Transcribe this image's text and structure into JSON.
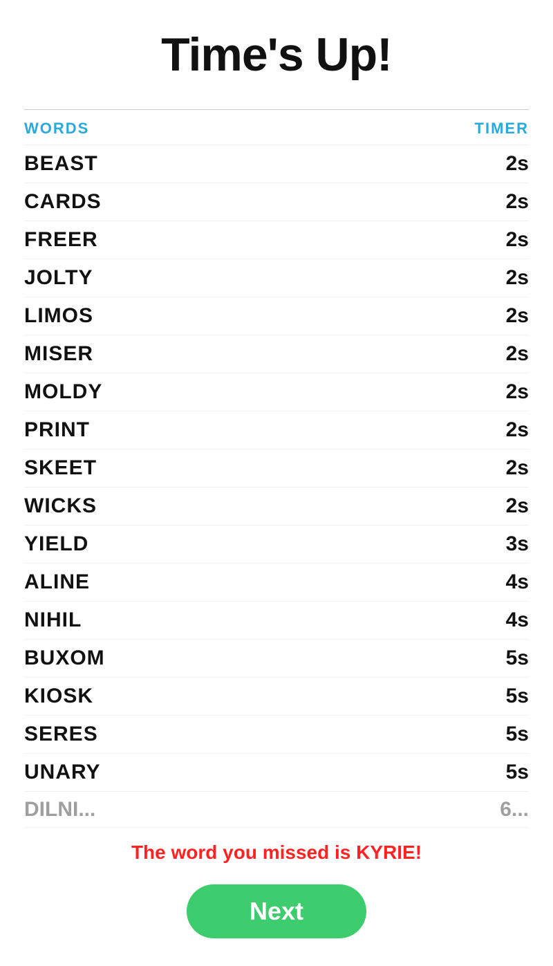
{
  "header": {
    "title": "Time's Up!"
  },
  "table": {
    "columns": {
      "words": "WORDS",
      "timer": "TIMER"
    },
    "rows": [
      {
        "word": "BEAST",
        "timer": "2s"
      },
      {
        "word": "CARDS",
        "timer": "2s"
      },
      {
        "word": "FREER",
        "timer": "2s"
      },
      {
        "word": "JOLTY",
        "timer": "2s"
      },
      {
        "word": "LIMOS",
        "timer": "2s"
      },
      {
        "word": "MISER",
        "timer": "2s"
      },
      {
        "word": "MOLDY",
        "timer": "2s"
      },
      {
        "word": "PRINT",
        "timer": "2s"
      },
      {
        "word": "SKEET",
        "timer": "2s"
      },
      {
        "word": "WICKS",
        "timer": "2s"
      },
      {
        "word": "YIELD",
        "timer": "3s"
      },
      {
        "word": "ALINE",
        "timer": "4s"
      },
      {
        "word": "NIHIL",
        "timer": "4s"
      },
      {
        "word": "BUXOM",
        "timer": "5s"
      },
      {
        "word": "KIOSK",
        "timer": "5s"
      },
      {
        "word": "SERES",
        "timer": "5s"
      },
      {
        "word": "UNARY",
        "timer": "5s"
      }
    ],
    "partial_row": {
      "word": "DILNI...",
      "timer": "6..."
    }
  },
  "missed_word_notice": "The word you missed is KYRIE!",
  "next_button": {
    "label": "Next"
  },
  "colors": {
    "accent_blue": "#29aadd",
    "accent_red": "#ff2222",
    "accent_green": "#3dcc6e"
  }
}
